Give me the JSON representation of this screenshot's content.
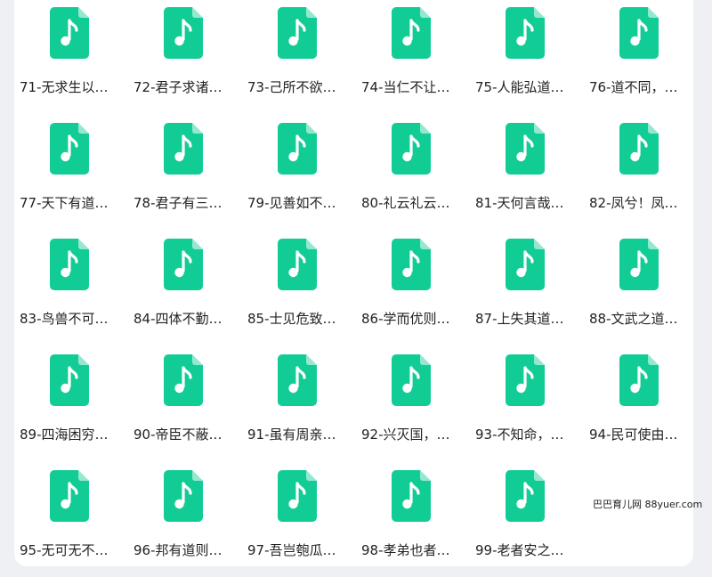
{
  "colors": {
    "icon_green": "#12cc96",
    "text": "#222222"
  },
  "file_icon": "music-file-icon",
  "files": [
    {
      "name": "71-无求生以…"
    },
    {
      "name": "72-君子求诸…"
    },
    {
      "name": "73-己所不欲…"
    },
    {
      "name": "74-当仁不让…"
    },
    {
      "name": "75-人能弘道…"
    },
    {
      "name": "76-道不同，…"
    },
    {
      "name": "77-天下有道…"
    },
    {
      "name": "78-君子有三…"
    },
    {
      "name": "79-见善如不…"
    },
    {
      "name": "80-礼云礼云…"
    },
    {
      "name": "81-天何言哉…"
    },
    {
      "name": "82-凤兮！凤…"
    },
    {
      "name": "83-鸟兽不可…"
    },
    {
      "name": "84-四体不勤…"
    },
    {
      "name": "85-士见危致…"
    },
    {
      "name": "86-学而优则…"
    },
    {
      "name": "87-上失其道…"
    },
    {
      "name": "88-文武之道…"
    },
    {
      "name": "89-四海困穷…"
    },
    {
      "name": "90-帝臣不蔽…"
    },
    {
      "name": "91-虽有周亲…"
    },
    {
      "name": "92-兴灭国，…"
    },
    {
      "name": "93-不知命，…"
    },
    {
      "name": "94-民可使由…"
    },
    {
      "name": "95-无可无不…"
    },
    {
      "name": "96-邦有道则…"
    },
    {
      "name": "97-吾岂匏瓜…"
    },
    {
      "name": "98-孝弟也者…"
    },
    {
      "name": "99-老者安之…"
    }
  ],
  "watermark": "巴巴育儿网 88yuer.com"
}
